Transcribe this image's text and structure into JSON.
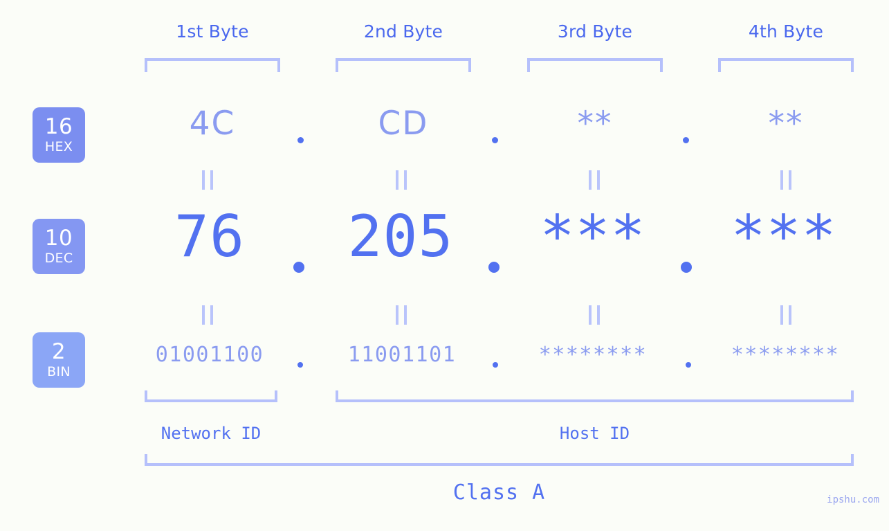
{
  "page": {
    "background_color": "#fbfdf8",
    "accent_strong": "#5271f0",
    "accent_light": "#8a9bf0",
    "accent_pale": "#b5c0fb",
    "watermark": "ipshu.com"
  },
  "byte_headers": [
    {
      "label": "1st Byte"
    },
    {
      "label": "2nd Byte"
    },
    {
      "label": "3rd Byte"
    },
    {
      "label": "4th Byte"
    }
  ],
  "radix_rows": [
    {
      "key": "hex",
      "badge_number": "16",
      "badge_name": "HEX",
      "badge_color": "#7b8ef0",
      "values": [
        "4C",
        "CD",
        "**",
        "**"
      ],
      "separator": "."
    },
    {
      "key": "dec",
      "badge_number": "10",
      "badge_name": "DEC",
      "badge_color": "#8497f2",
      "values": [
        "76",
        "205",
        "***",
        "***"
      ],
      "separator": "."
    },
    {
      "key": "bin",
      "badge_number": "2",
      "badge_name": "BIN",
      "badge_color": "#8ba6f6",
      "values": [
        "01001100",
        "11001101",
        "********",
        "********"
      ],
      "separator": "."
    }
  ],
  "equality_symbol": "=",
  "segments": {
    "network_id": "Network ID",
    "host_id": "Host ID"
  },
  "class_label": "Class A"
}
